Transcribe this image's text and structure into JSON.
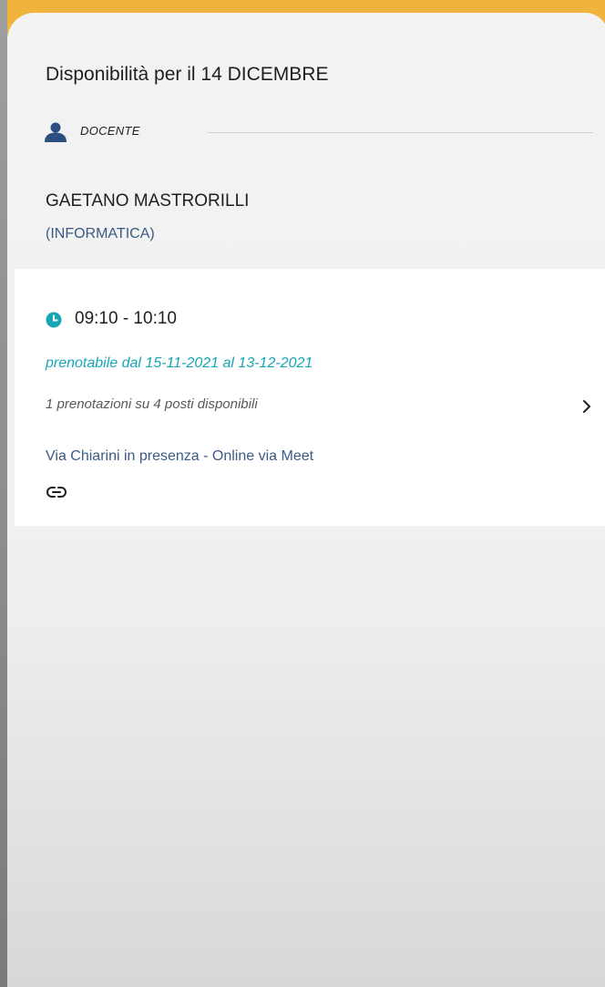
{
  "header": {
    "title": "Disponibilità per il 14 DICEMBRE"
  },
  "role": {
    "icon": "person-icon",
    "label": "DOCENTE"
  },
  "teacher": {
    "name": "GAETANO MASTRORILLI",
    "subject": "(INFORMATICA)"
  },
  "slots": [
    {
      "clock_icon": "clock-icon",
      "time": "09:10 - 10:10",
      "booking_window": "prenotabile dal 15-11-2021 al 13-12-2021",
      "capacity": "1 prenotazioni su 4 posti disponibili",
      "location": "Via Chiarini in presenza  - Online via Meet",
      "link_icon": "link-icon",
      "chevron_icon": "chevron-right-icon"
    }
  ],
  "colors": {
    "accent_top": "#f0b43c",
    "teal": "#17a6b4",
    "navy": "#3b5a86",
    "person_icon": "#2c4f7f"
  }
}
